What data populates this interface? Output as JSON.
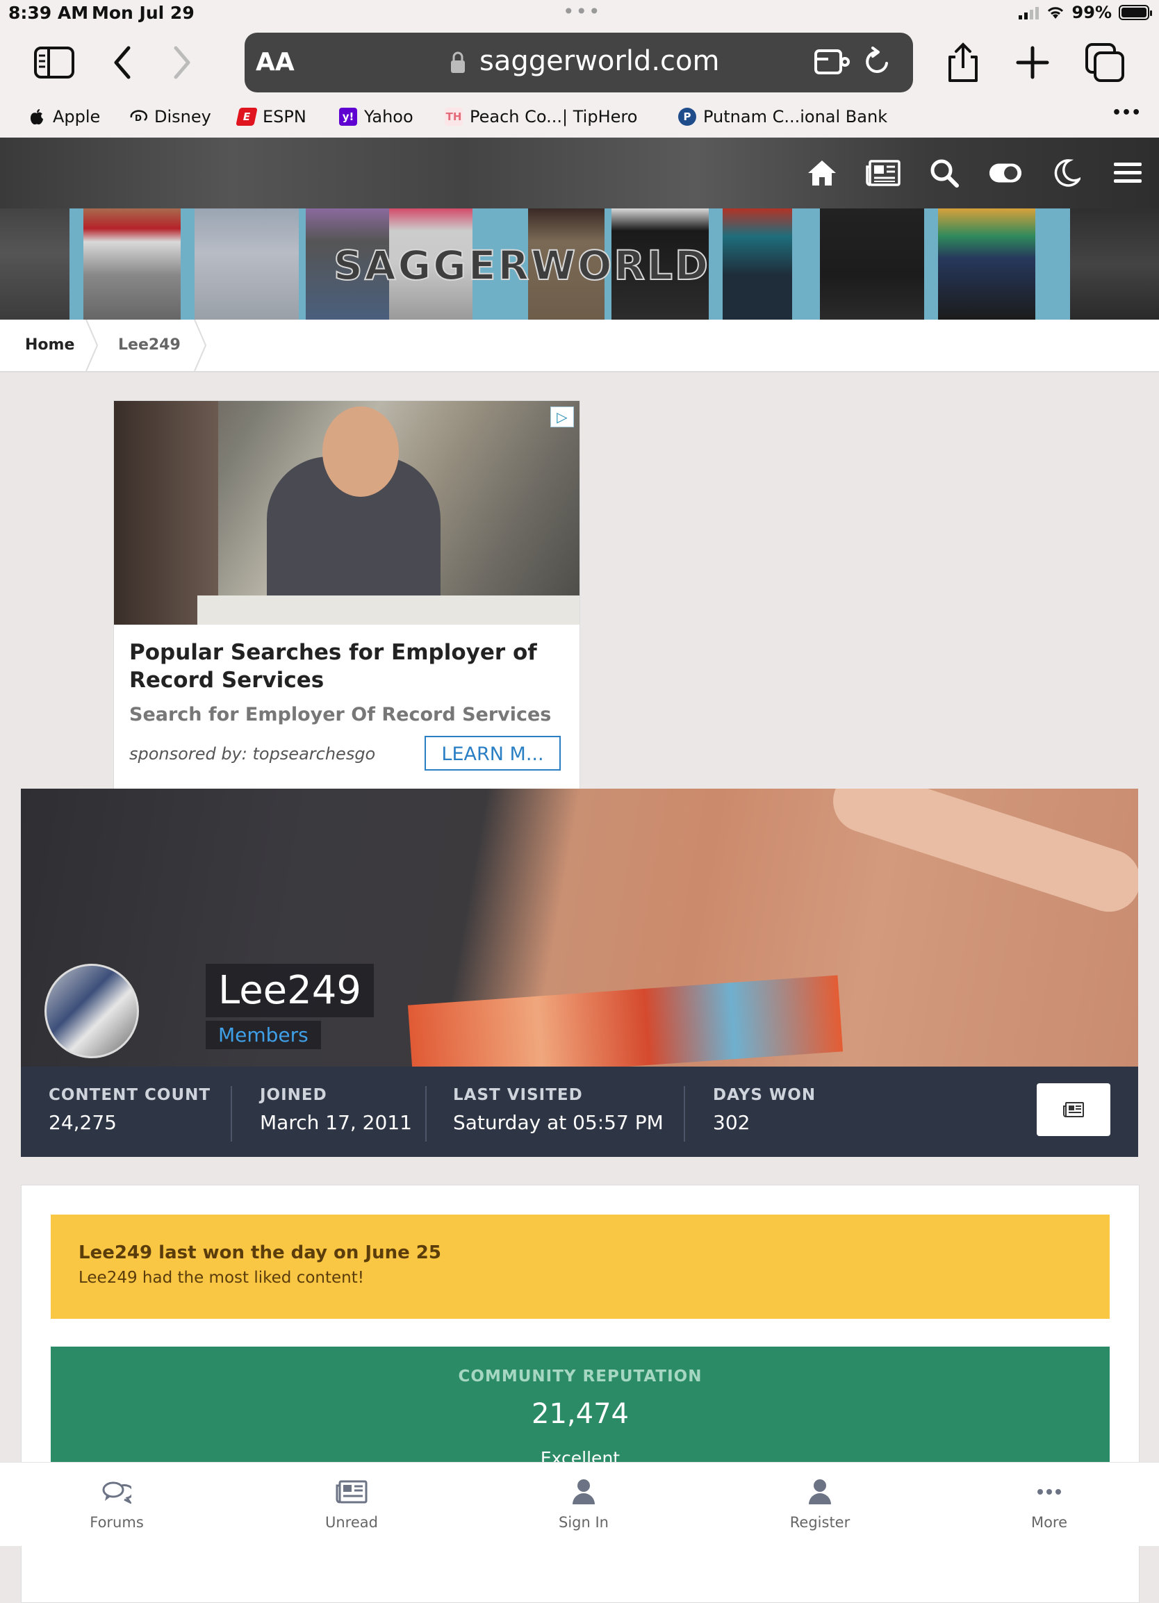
{
  "status_bar": {
    "time": "8:39 AM",
    "date": "Mon Jul 29",
    "battery": "99%"
  },
  "browser": {
    "text_size_label": "AA",
    "url": "saggerworld.com",
    "favorites": [
      {
        "label": "Apple",
        "icon": "apple-icon"
      },
      {
        "label": "Disney",
        "icon": "disney-icon"
      },
      {
        "label": "ESPN",
        "icon": "espn-icon"
      },
      {
        "label": "Yahoo",
        "icon": "yahoo-icon",
        "badge": "y!"
      },
      {
        "label": "Peach Co...| TipHero",
        "icon": "tiphero-icon",
        "badge": "TH"
      },
      {
        "label": "Putnam C...ional Bank",
        "icon": "putnam-icon",
        "badge": "P"
      }
    ],
    "more_label": "•••"
  },
  "site": {
    "logo_text": "SAGGERWORLD",
    "nav_icons": [
      "home-icon",
      "news-icon",
      "search-icon",
      "theme-toggle-icon",
      "dark-mode-icon",
      "menu-icon"
    ]
  },
  "breadcrumb": {
    "home": "Home",
    "current": "Lee249"
  },
  "ad": {
    "choices_mark": "▷",
    "title": "Popular Searches for Employer of Record Services",
    "subtitle": "Search for Employer Of Record Services",
    "sponsor": "sponsored by: topsearchesgo",
    "cta": "LEARN M..."
  },
  "profile": {
    "username": "Lee249",
    "group": "Members",
    "stats": [
      {
        "label": "CONTENT COUNT",
        "value": "24,275"
      },
      {
        "label": "JOINED",
        "value": "March 17, 2011"
      },
      {
        "label": "LAST VISITED",
        "value": "Saturday at 05:57 PM"
      },
      {
        "label": "DAYS WON",
        "value": "302"
      }
    ]
  },
  "day_alert": {
    "title": "Lee249 last won the day on June 25",
    "text": "Lee249 had the most liked content!"
  },
  "reputation": {
    "label": "COMMUNITY REPUTATION",
    "value": "21,474",
    "level": "Excellent"
  },
  "tabbar": [
    {
      "label": "Forums",
      "icon": "forums-icon"
    },
    {
      "label": "Unread",
      "icon": "unread-icon"
    },
    {
      "label": "Sign In",
      "icon": "user-icon"
    },
    {
      "label": "Register",
      "icon": "user-icon"
    },
    {
      "label": "More",
      "icon": "more-icon"
    }
  ],
  "colors": {
    "stats_bg": "#2e3544",
    "alert_bg": "#f9c744",
    "reputation_bg": "#2c8b67",
    "group_link": "#3fa0e8"
  }
}
